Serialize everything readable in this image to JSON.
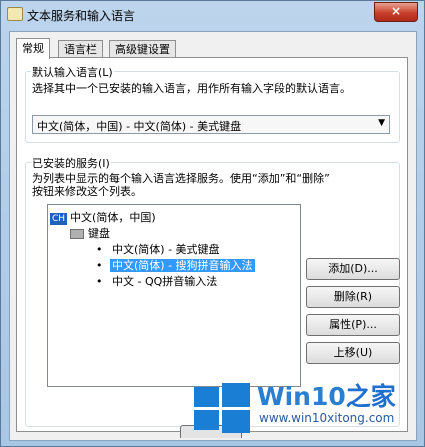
{
  "window": {
    "title": "文本服务和输入语言",
    "close_glyph": "×"
  },
  "tabs": [
    "常规",
    "语言栏",
    "高级键设置"
  ],
  "default_language": {
    "label": "默认输入语言(L)",
    "description": "选择其中一个已安装的输入语言，用作所有输入字段的默认语言。",
    "selected": "中文(简体，中国) - 中文(简体) - 美式键盘"
  },
  "installed_services": {
    "label": "已安装的服务(I)",
    "description_line1": "为列表中显示的每个输入语言选择服务。使用“添加”和“删除”",
    "description_line2": "按钮来修改这个列表。",
    "tree": {
      "language_badge": "CH",
      "language": "中文(简体，中国)",
      "keyboard_group": "键盘",
      "items": [
        {
          "bullet": "•",
          "label": "中文(简体) - 美式键盘",
          "selected": false
        },
        {
          "bullet": "•",
          "label": "中文(简体) - 搜狗拼音输入法",
          "selected": true
        },
        {
          "bullet": "•",
          "label": "中文 - QQ拼音输入法",
          "selected": false
        }
      ]
    },
    "buttons": {
      "add": "添加(D)...",
      "remove": "删除(R)",
      "properties": "属性(P)...",
      "move_up": "上移(U)"
    }
  },
  "watermark": {
    "title_main": "Win10",
    "title_accent": "之家",
    "url": "www.win10xitong.com"
  }
}
